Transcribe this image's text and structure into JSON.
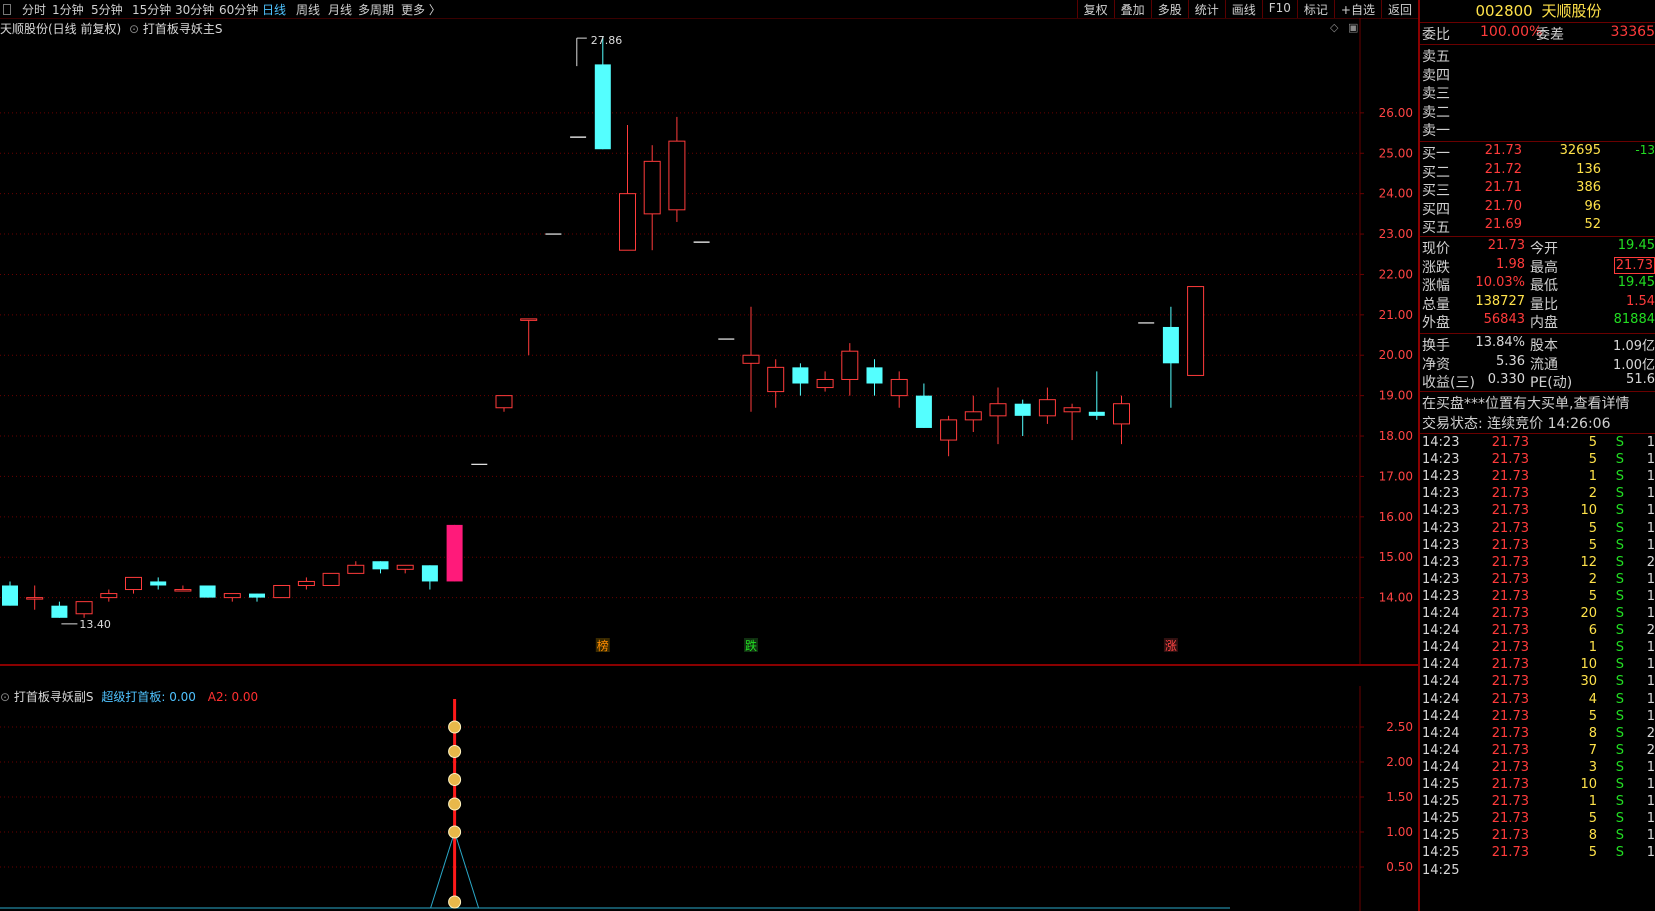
{
  "toolbar": {
    "periods": [
      "分时",
      "1分钟",
      "5分钟",
      "15分钟",
      "30分钟",
      "60分钟",
      "日线",
      "周线",
      "月线",
      "多周期",
      "更多 〉"
    ],
    "active": "日线",
    "right": [
      "复权",
      "叠加",
      "多股",
      "统计",
      "画线",
      "F10",
      "标记",
      "+自选",
      "返回"
    ]
  },
  "chart": {
    "stock_label": "天顺股份(日线 前复权)",
    "indicator": "打首板寻妖主S",
    "high_label": "27.86",
    "low_label": "13.40",
    "y_ticks": [
      "26.00",
      "25.00",
      "24.00",
      "23.00",
      "22.00",
      "21.00",
      "20.00",
      "19.00",
      "18.00",
      "17.00",
      "16.00",
      "15.00",
      "14.00"
    ],
    "markers": [
      "榜",
      "跌",
      "涨"
    ],
    "sub_ind": "打首板寻妖副S",
    "sub_val1": "超级打首板: 0.00",
    "sub_val2": "A2: 0.00",
    "sub_ticks": [
      "2.50",
      "2.00",
      "1.50",
      "1.00",
      "0.50"
    ],
    "colors": {
      "up": "#ff3b3b",
      "down": "#54ffff",
      "limit": "#ff1a7a",
      "grid": "#6a0000"
    }
  },
  "chart_data": {
    "type": "candlestick",
    "ylim": [
      13.0,
      28.2
    ],
    "candles": [
      [
        14.3,
        14.4,
        13.8,
        13.8
      ],
      [
        14.0,
        14.3,
        13.7,
        14.0
      ],
      [
        13.8,
        13.9,
        13.5,
        13.5
      ],
      [
        13.6,
        13.9,
        13.5,
        13.9
      ],
      [
        14.0,
        14.2,
        13.9,
        14.1
      ],
      [
        14.2,
        14.5,
        14.1,
        14.5
      ],
      [
        14.4,
        14.5,
        14.2,
        14.3
      ],
      [
        14.2,
        14.3,
        14.2,
        14.2
      ],
      [
        14.3,
        14.3,
        14.0,
        14.0
      ],
      [
        14.0,
        14.1,
        13.9,
        14.1
      ],
      [
        14.1,
        14.1,
        13.9,
        14.0
      ],
      [
        14.0,
        14.3,
        14.0,
        14.3
      ],
      [
        14.3,
        14.5,
        14.2,
        14.4
      ],
      [
        14.3,
        14.6,
        14.3,
        14.6
      ],
      [
        14.6,
        14.9,
        14.6,
        14.8
      ],
      [
        14.9,
        14.9,
        14.6,
        14.7
      ],
      [
        14.7,
        14.8,
        14.6,
        14.8
      ],
      [
        14.8,
        14.8,
        14.2,
        14.4
      ],
      [
        14.4,
        15.8,
        14.4,
        15.8
      ],
      [
        17.3,
        17.3,
        17.3,
        17.3
      ],
      [
        18.7,
        19.0,
        18.6,
        19.0
      ],
      [
        20.9,
        20.9,
        20.0,
        20.9
      ],
      [
        23.0,
        23.0,
        23.0,
        23.0
      ],
      [
        25.4,
        25.4,
        25.4,
        25.4
      ],
      [
        27.2,
        27.9,
        25.1,
        25.1
      ],
      [
        22.6,
        25.7,
        22.6,
        24.0
      ],
      [
        23.5,
        25.2,
        22.6,
        24.8
      ],
      [
        23.6,
        25.9,
        23.3,
        25.3
      ],
      [
        22.8,
        22.8,
        22.8,
        22.8
      ],
      [
        20.4,
        20.4,
        20.4,
        20.4
      ],
      [
        19.8,
        21.2,
        18.6,
        20.0
      ],
      [
        19.1,
        19.9,
        18.7,
        19.7
      ],
      [
        19.7,
        19.8,
        19.0,
        19.3
      ],
      [
        19.2,
        19.6,
        19.1,
        19.4
      ],
      [
        19.4,
        20.3,
        19.0,
        20.1
      ],
      [
        19.7,
        19.9,
        19.0,
        19.3
      ],
      [
        19.0,
        19.6,
        18.7,
        19.4
      ],
      [
        19.0,
        19.3,
        18.2,
        18.2
      ],
      [
        17.9,
        18.5,
        17.5,
        18.4
      ],
      [
        18.4,
        19.0,
        18.1,
        18.6
      ],
      [
        18.5,
        19.2,
        17.8,
        18.8
      ],
      [
        18.8,
        18.9,
        18.0,
        18.5
      ],
      [
        18.5,
        19.2,
        18.3,
        18.9
      ],
      [
        18.6,
        18.8,
        17.9,
        18.7
      ],
      [
        18.6,
        19.6,
        18.4,
        18.5
      ],
      [
        18.3,
        19.0,
        17.8,
        18.8
      ],
      [
        20.8,
        20.8,
        20.8,
        20.8
      ],
      [
        20.7,
        21.2,
        18.7,
        19.8
      ],
      [
        19.5,
        21.7,
        19.5,
        21.7
      ]
    ],
    "sub_signal": {
      "index": 18,
      "value": 2.5
    }
  },
  "panel": {
    "code": "002800",
    "name": "天顺股份",
    "weibi_label": "委比",
    "weibi": "100.00%",
    "weicha_label": "委差",
    "weicha": "33365",
    "sells": [
      "卖五",
      "卖四",
      "卖三",
      "卖二",
      "卖一"
    ],
    "buys": [
      {
        "label": "买一",
        "price": "21.73",
        "vol": "32695",
        "chg": "-13"
      },
      {
        "label": "买二",
        "price": "21.72",
        "vol": "136",
        "chg": ""
      },
      {
        "label": "买三",
        "price": "21.71",
        "vol": "386",
        "chg": ""
      },
      {
        "label": "买四",
        "price": "21.70",
        "vol": "96",
        "chg": ""
      },
      {
        "label": "买五",
        "price": "21.69",
        "vol": "52",
        "chg": ""
      }
    ],
    "stats": [
      {
        "l1": "现价",
        "v1": "21.73",
        "c1": "red",
        "l2": "今开",
        "v2": "19.45",
        "c2": "grn"
      },
      {
        "l1": "涨跌",
        "v1": "1.98",
        "c1": "red",
        "l2": "最高",
        "v2": "21.73",
        "c2": "red"
      },
      {
        "l1": "涨幅",
        "v1": "10.03%",
        "c1": "red",
        "l2": "最低",
        "v2": "19.45",
        "c2": "grn"
      },
      {
        "l1": "总量",
        "v1": "138727",
        "c1": "yel",
        "l2": "量比",
        "v2": "1.54",
        "c2": "red"
      },
      {
        "l1": "外盘",
        "v1": "56843",
        "c1": "red",
        "l2": "内盘",
        "v2": "81884",
        "c2": "grn"
      }
    ],
    "stats2": [
      {
        "l1": "换手",
        "v1": "13.84%",
        "l2": "股本",
        "v2": "1.09亿"
      },
      {
        "l1": "净资",
        "v1": "5.36",
        "l2": "流通",
        "v2": "1.00亿"
      },
      {
        "l1": "收益(三)",
        "v1": "0.330",
        "l2": "PE(动)",
        "v2": "51.6"
      }
    ],
    "notice": "在买盘***位置有大买单,查看详情",
    "status": "交易状态: 连续竞价 14:26:06",
    "ticks": [
      [
        "14:23",
        "21.73",
        "5",
        "S",
        "1"
      ],
      [
        "14:23",
        "21.73",
        "5",
        "S",
        "1"
      ],
      [
        "14:23",
        "21.73",
        "1",
        "S",
        "1"
      ],
      [
        "14:23",
        "21.73",
        "2",
        "S",
        "1"
      ],
      [
        "14:23",
        "21.73",
        "10",
        "S",
        "1"
      ],
      [
        "14:23",
        "21.73",
        "5",
        "S",
        "1"
      ],
      [
        "14:23",
        "21.73",
        "5",
        "S",
        "1"
      ],
      [
        "14:23",
        "21.73",
        "12",
        "S",
        "2"
      ],
      [
        "14:23",
        "21.73",
        "2",
        "S",
        "1"
      ],
      [
        "14:23",
        "21.73",
        "5",
        "S",
        "1"
      ],
      [
        "14:24",
        "21.73",
        "20",
        "S",
        "1"
      ],
      [
        "14:24",
        "21.73",
        "6",
        "S",
        "2"
      ],
      [
        "14:24",
        "21.73",
        "1",
        "S",
        "1"
      ],
      [
        "14:24",
        "21.73",
        "10",
        "S",
        "1"
      ],
      [
        "14:24",
        "21.73",
        "30",
        "S",
        "1"
      ],
      [
        "14:24",
        "21.73",
        "4",
        "S",
        "1"
      ],
      [
        "14:24",
        "21.73",
        "5",
        "S",
        "1"
      ],
      [
        "14:24",
        "21.73",
        "8",
        "S",
        "2"
      ],
      [
        "14:24",
        "21.73",
        "7",
        "S",
        "2"
      ],
      [
        "14:24",
        "21.73",
        "3",
        "S",
        "1"
      ],
      [
        "14:25",
        "21.73",
        "10",
        "S",
        "1"
      ],
      [
        "14:25",
        "21.73",
        "1",
        "S",
        "1"
      ],
      [
        "14:25",
        "21.73",
        "5",
        "S",
        "1"
      ],
      [
        "14:25",
        "21.73",
        "8",
        "S",
        "1"
      ],
      [
        "14:25",
        "21.73",
        "5",
        "S",
        "1"
      ],
      [
        "14:25",
        "",
        "",
        "",
        ""
      ]
    ]
  }
}
